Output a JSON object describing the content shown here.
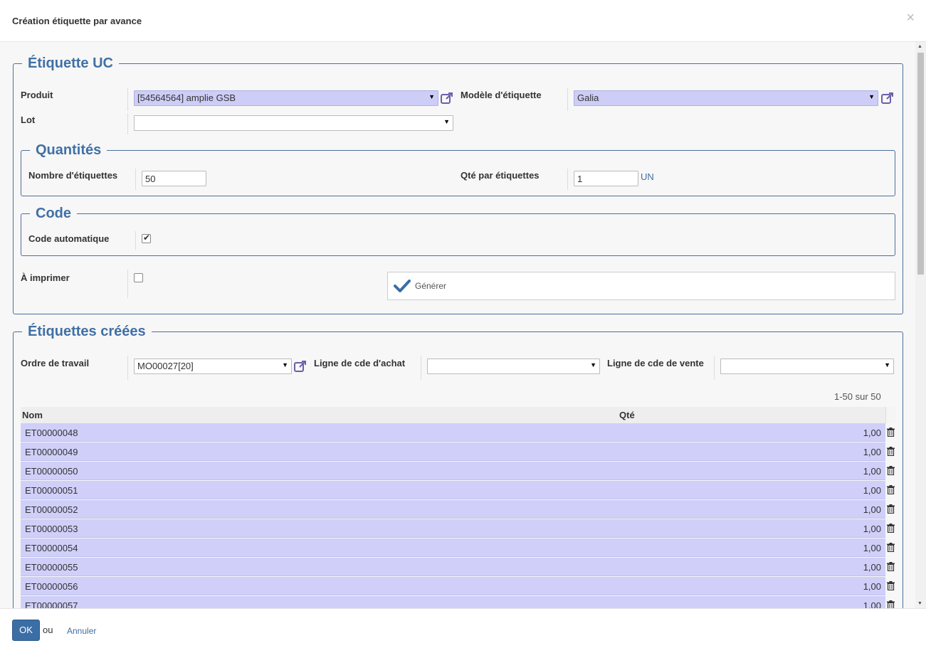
{
  "dialog": {
    "title": "Création étiquette par avance",
    "close_glyph": "×"
  },
  "uc": {
    "legend": "Étiquette UC",
    "produit_label": "Produit",
    "produit_value": "[54564564] amplie GSB",
    "lot_label": "Lot",
    "lot_value": "",
    "modele_label": "Modèle d'étiquette",
    "modele_value": "Galia"
  },
  "quantites": {
    "legend": "Quantités",
    "nb_label": "Nombre d'étiquettes",
    "nb_value": "50",
    "qte_label": "Qté par étiquettes",
    "qte_value": "1",
    "unit": "UN"
  },
  "code": {
    "legend": "Code",
    "auto_label": "Code automatique",
    "auto_checked": true
  },
  "imprimer": {
    "label": "À imprimer",
    "checked": false
  },
  "generate_button": {
    "label": "Générer",
    "icon": "checkmark-icon"
  },
  "crees": {
    "legend": "Étiquettes créées",
    "ordre_label": "Ordre de travail",
    "ordre_value": "MO00027[20]",
    "achat_label": "Ligne de cde d'achat",
    "achat_value": "",
    "vente_label": "Ligne de cde de vente",
    "vente_value": "",
    "pager": "1-50 sur 50",
    "columns": {
      "nom": "Nom",
      "qte": "Qté"
    },
    "rows": [
      {
        "nom": "ET00000048",
        "qte": "1,00"
      },
      {
        "nom": "ET00000049",
        "qte": "1,00"
      },
      {
        "nom": "ET00000050",
        "qte": "1,00"
      },
      {
        "nom": "ET00000051",
        "qte": "1,00"
      },
      {
        "nom": "ET00000052",
        "qte": "1,00"
      },
      {
        "nom": "ET00000053",
        "qte": "1,00"
      },
      {
        "nom": "ET00000054",
        "qte": "1,00"
      },
      {
        "nom": "ET00000055",
        "qte": "1,00"
      },
      {
        "nom": "ET00000056",
        "qte": "1,00"
      },
      {
        "nom": "ET00000057",
        "qte": "1,00"
      }
    ]
  },
  "footer": {
    "ok_label": "OK",
    "ou_text": "ou",
    "cancel_label": "Annuler"
  },
  "colors": {
    "accent": "#4170a5",
    "selection": "#cfcff9",
    "ok_button": "#3b6ea5"
  },
  "icons": {
    "dropdown": "caret-down-icon",
    "external": "external-link-icon",
    "delete": "trash-icon",
    "close": "close-icon"
  }
}
